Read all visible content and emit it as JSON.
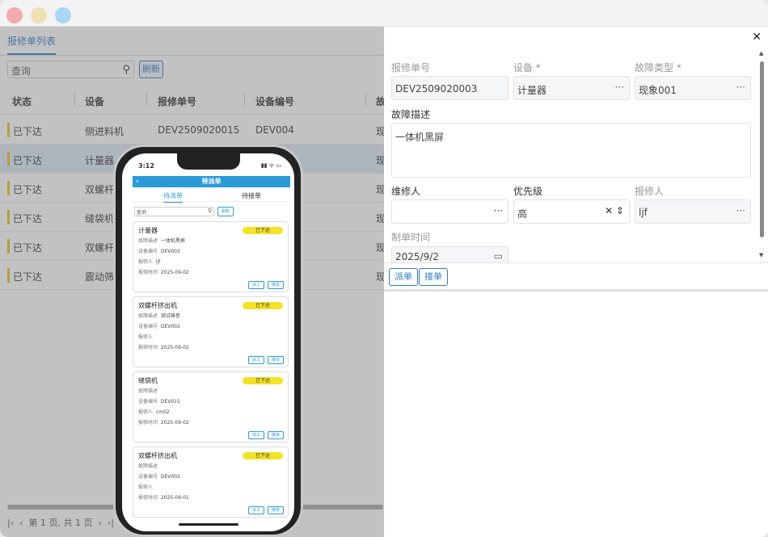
{
  "list_panel": {
    "tab_title": "报修单列表",
    "search_placeholder": "查询",
    "refresh_label": "刷新",
    "columns": [
      "状态",
      "设备",
      "报修单号",
      "设备编号",
      "故"
    ],
    "rows": [
      {
        "status": "已下达",
        "device": "侧进料机",
        "order_no": "DEV2509020015",
        "device_no": "DEV004",
        "fault": "现"
      },
      {
        "status": "已下达",
        "device": "计量器",
        "order_no": "",
        "device_no": "",
        "fault": "现"
      },
      {
        "status": "已下达",
        "device": "双螺杆挤",
        "order_no": "",
        "device_no": "",
        "fault": "现"
      },
      {
        "status": "已下达",
        "device": "缝袋机(",
        "order_no": "",
        "device_no": "",
        "fault": "现"
      },
      {
        "status": "已下达",
        "device": "双螺杆挤",
        "order_no": "",
        "device_no": "",
        "fault": "现"
      },
      {
        "status": "已下达",
        "device": "震动筛",
        "order_no": "",
        "device_no": "",
        "fault": "现"
      }
    ],
    "pager": "第 1 页, 共 1 页"
  },
  "detail_panel": {
    "close_icon": "close-icon",
    "fields": {
      "order_no_label": "报修单号",
      "order_no_value": "DEV2509020003",
      "device_label": "设备 *",
      "device_value": "计量器",
      "fault_type_label": "故障类型 *",
      "fault_type_value": "现象001",
      "fault_desc_label": "故障描述",
      "fault_desc_value": "一体机黑屏",
      "repairer_label": "维修人",
      "repairer_value": "",
      "priority_label": "优先级",
      "priority_value": "高",
      "reporter_label": "报修人",
      "reporter_value": "ljf",
      "created_label": "制单时间",
      "created_value": "2025/9/2"
    },
    "dispatch_label": "派单",
    "accept_label": "接单"
  },
  "phone": {
    "time": "3:12",
    "status_icons": "▮▮ ᯤ ▭",
    "title": "待派单",
    "tabs": [
      "待派单",
      "待接单"
    ],
    "search_placeholder": "查询",
    "refresh_label": "刷新",
    "desc_key": "故障描述",
    "devno_key": "设备编号",
    "reporter_key": "报修人",
    "time_key": "报修时间",
    "dispatch_label": "派工",
    "accept_label": "接单",
    "cards": [
      {
        "title": "计量器",
        "status": "已下达",
        "desc": "一体机黑屏",
        "device_no": "DEV003",
        "reporter": "ljf",
        "time": "2025-09-02"
      },
      {
        "title": "双螺杆挤出机",
        "status": "已下达",
        "desc": "测试噪音",
        "device_no": "DEV002",
        "reporter": "",
        "time": "2025-09-02"
      },
      {
        "title": "缝袋机",
        "status": "已下达",
        "desc": "",
        "device_no": "DEV015",
        "reporter": "cm02",
        "time": "2025-09-02"
      },
      {
        "title": "双螺杆挤出机",
        "status": "已下达",
        "desc": "",
        "device_no": "DEV002",
        "reporter": "",
        "time": "2025-09-01"
      }
    ]
  }
}
